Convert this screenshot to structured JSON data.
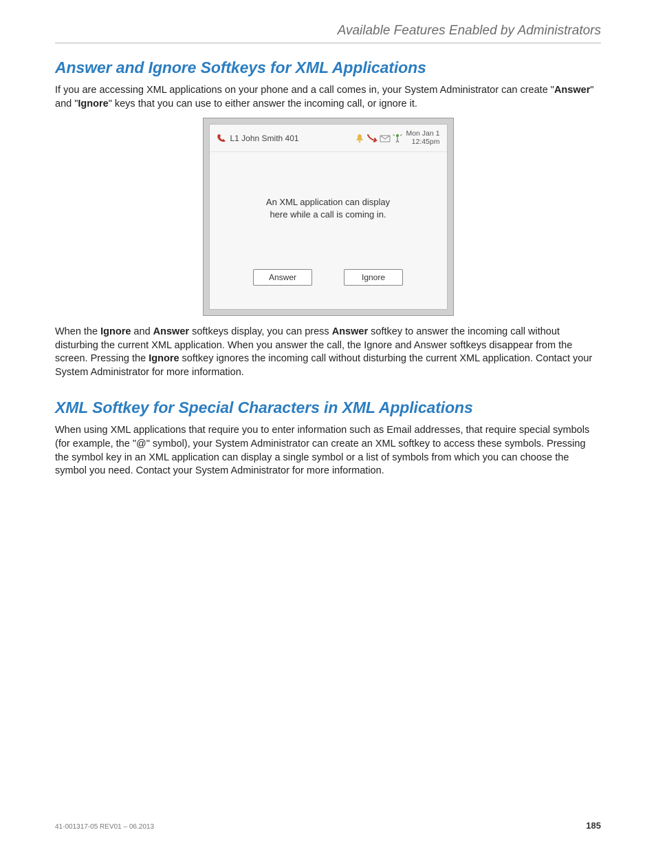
{
  "header": {
    "running_title": "Available Features Enabled by Administrators"
  },
  "section1": {
    "title": "Answer and Ignore Softkeys for XML Applications",
    "para1_a": "If you are accessing XML applications on your phone and a call comes in, your System Administrator can create \"",
    "para1_answer": "Answer",
    "para1_b": "\" and \"",
    "para1_ignore": "Ignore",
    "para1_c": "\" keys that you can use to either answer the incoming call, or ignore it.",
    "para2_a": "When the ",
    "para2_ignore": "Ignore",
    "para2_b": " and ",
    "para2_answer1": "Answer",
    "para2_c": " softkeys display, you can press ",
    "para2_answer2": "Answer",
    "para2_d": " softkey to answer the incoming call without disturbing the current XML application. When you answer the call, the Ignore and Answer softkeys disappear from the screen. Pressing the ",
    "para2_ignore2": "Ignore",
    "para2_e": " softkey ignores the incoming call without disturbing the current XML application. Contact your System Administrator for more information."
  },
  "phone": {
    "line_label": "L1 John Smith 401",
    "date": "Mon Jan 1",
    "time": "12:45pm",
    "body_line1": "An XML application can display",
    "body_line2": "here while a call is coming in.",
    "softkey_answer": "Answer",
    "softkey_ignore": "Ignore"
  },
  "section2": {
    "title": "XML Softkey for Special Characters in XML Applications",
    "para": "When using XML applications that require you to enter information such as Email addresses, that require special symbols (for example, the \"@\" symbol), your System Administrator can create an XML softkey to access these symbols. Pressing the symbol key in an XML application can display a single symbol or a list of symbols from which you can choose the symbol you need. Contact your System Administrator for more information."
  },
  "footer": {
    "docid": "41-001317-05 REV01 – 06.2013",
    "page": "185"
  }
}
